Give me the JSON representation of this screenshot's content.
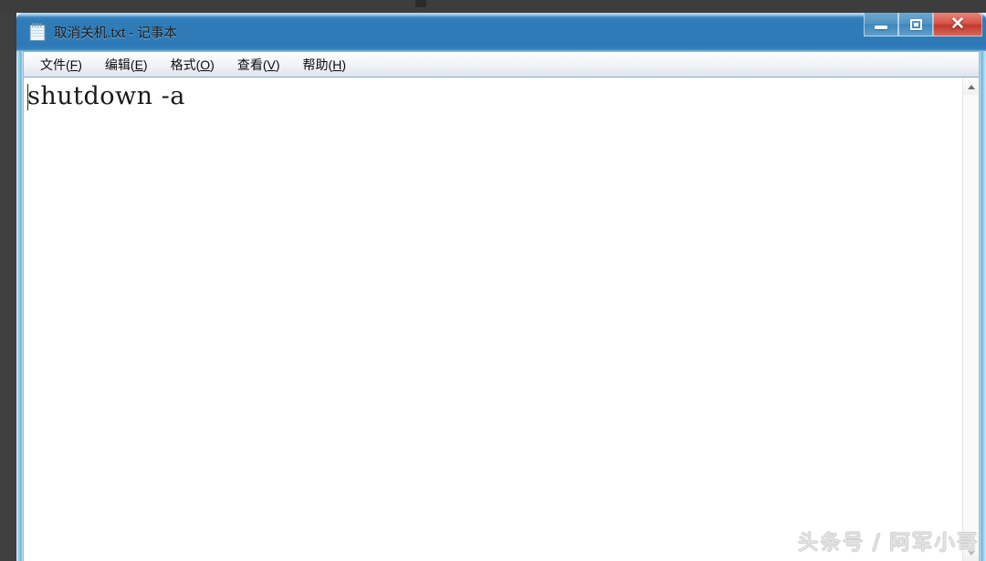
{
  "window": {
    "title": "取消关机.txt - 记事本",
    "icon": "notepad-icon",
    "controls": {
      "minimize_label": "─",
      "maximize_label": "□",
      "close_label": "✕"
    }
  },
  "menu": {
    "items": [
      {
        "label": "文件",
        "accel": "F"
      },
      {
        "label": "编辑",
        "accel": "E"
      },
      {
        "label": "格式",
        "accel": "O"
      },
      {
        "label": "查看",
        "accel": "V"
      },
      {
        "label": "帮助",
        "accel": "H"
      }
    ]
  },
  "editor": {
    "text": "shutdown -a",
    "placeholder": ""
  },
  "scrollbar": {
    "up_arrow": "▲",
    "down_arrow": "▼"
  },
  "watermark": {
    "text": "头条号 / 阿军小哥"
  },
  "colors": {
    "titlebar_blue": "#2e7ab6",
    "close_red": "#c2392c",
    "desktop_dark": "#3f3f3f",
    "client_white": "#ffffff",
    "watermark_gray": "#e3e3e3"
  }
}
